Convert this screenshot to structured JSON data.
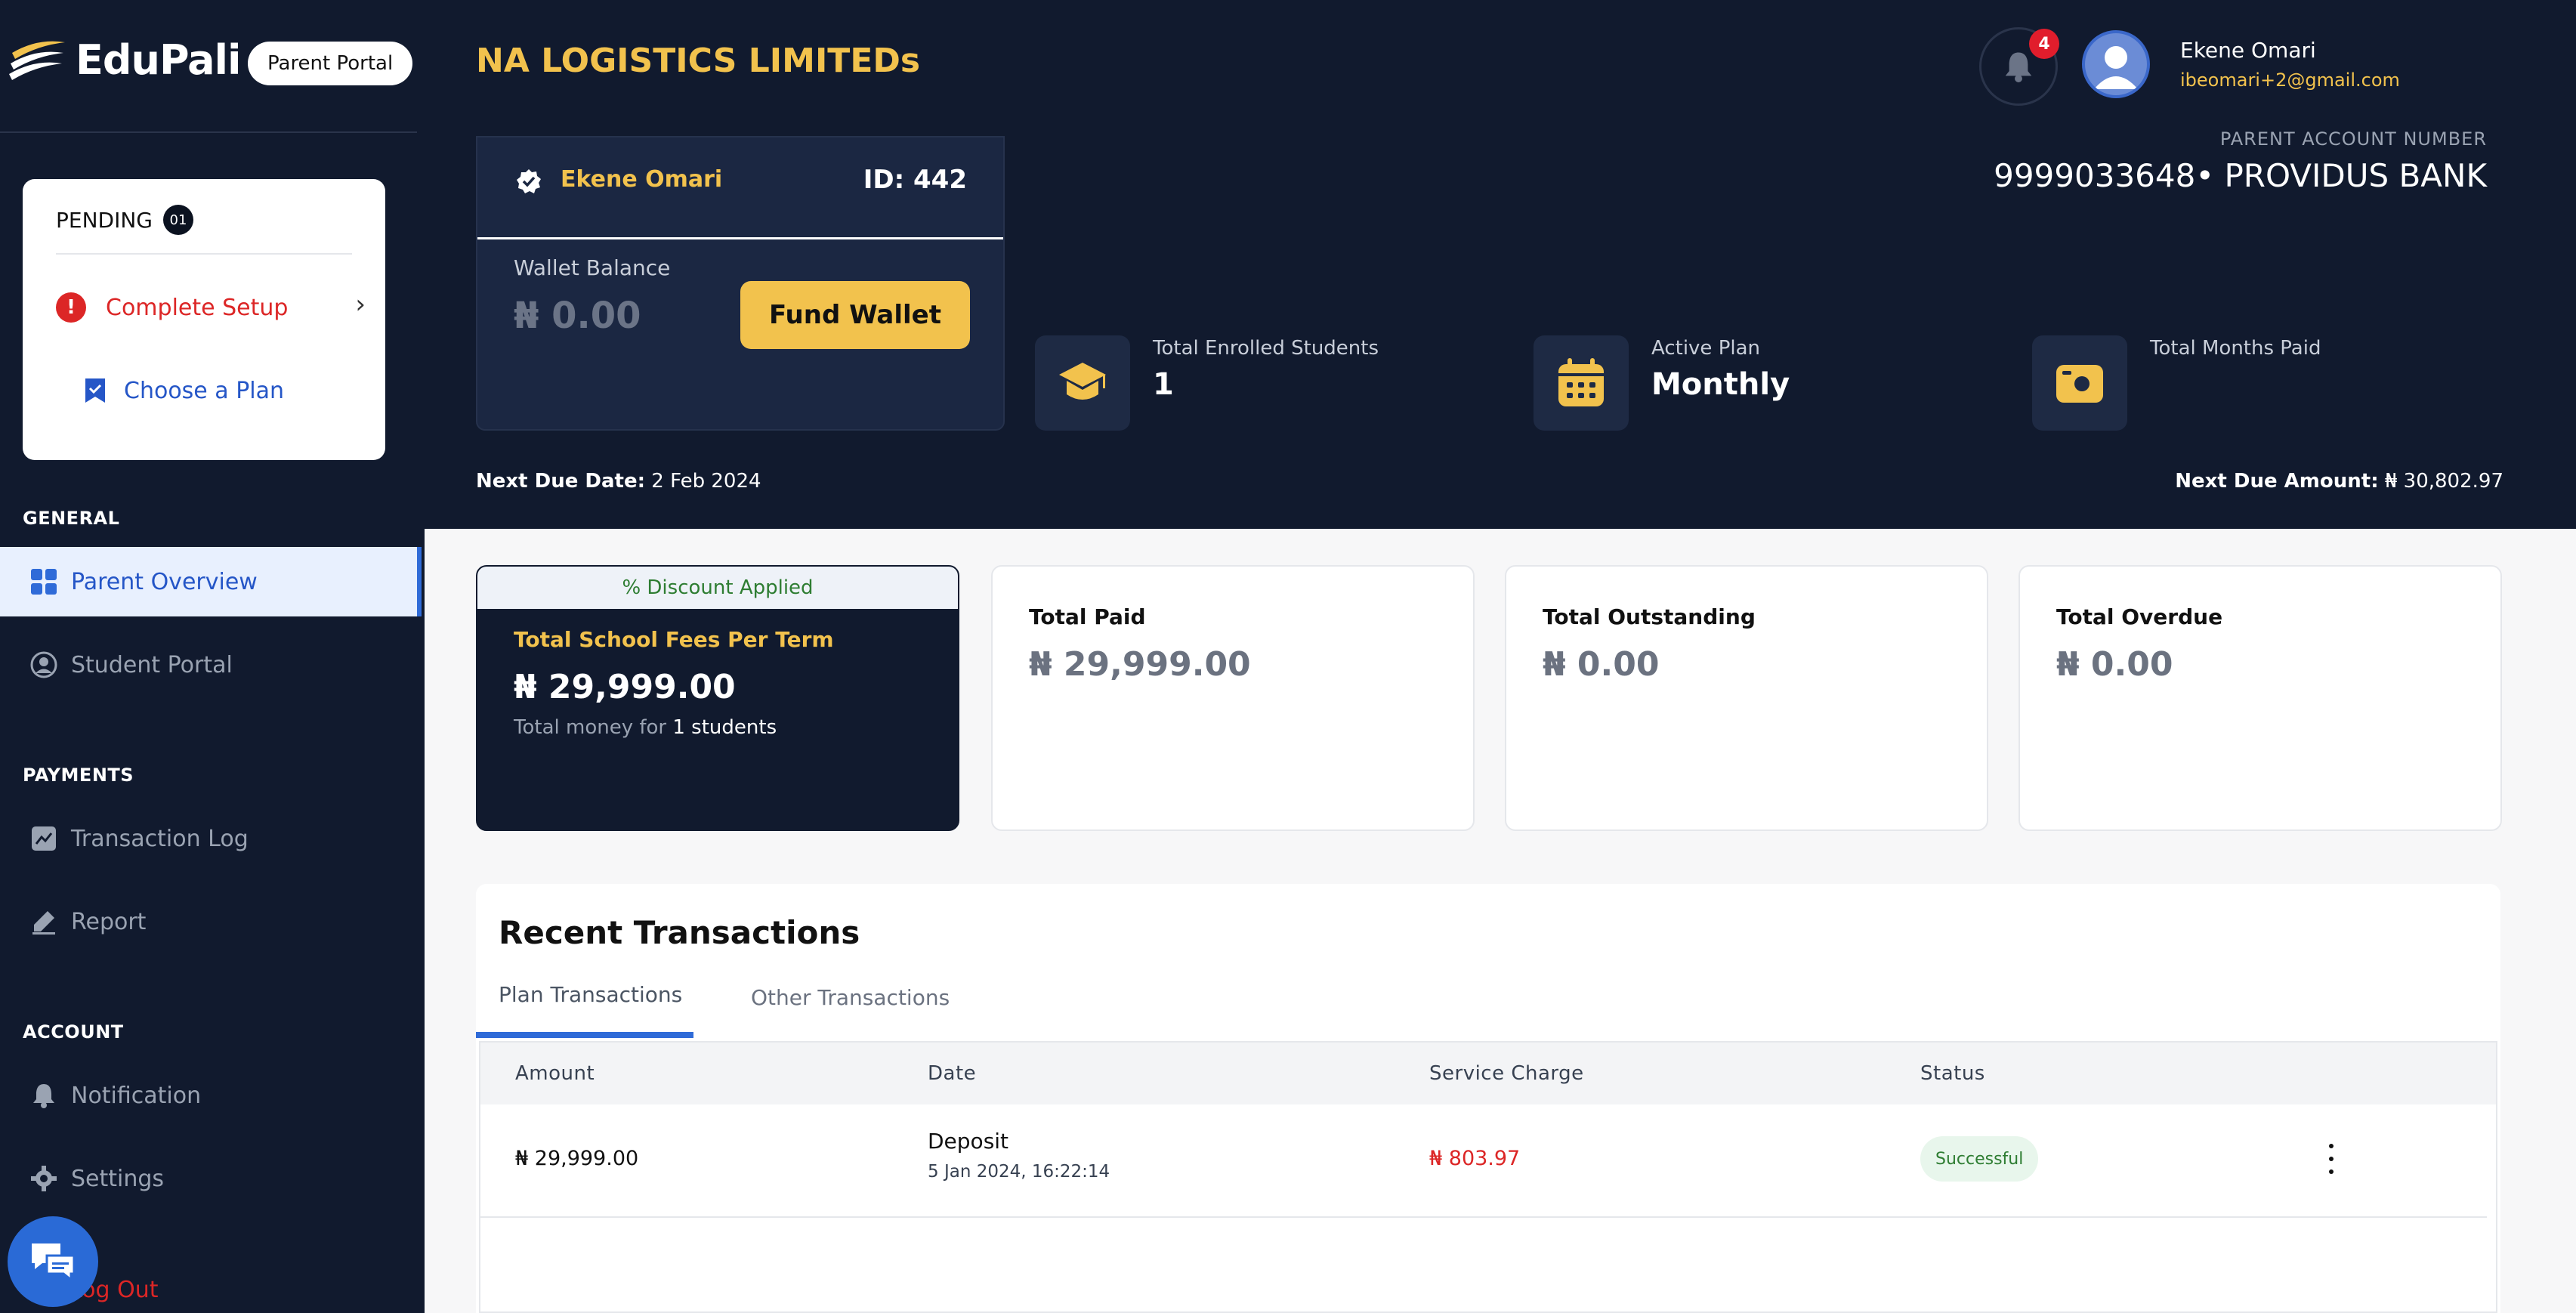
{
  "sidebar": {
    "brand": "EduPali",
    "portal_label": "Parent Portal",
    "pending": {
      "title": "PENDING",
      "count": "01",
      "setup_label": "Complete Setup",
      "plan_label": "Choose a Plan"
    },
    "sections": {
      "general": "GENERAL",
      "payments": "PAYMENTS",
      "account": "ACCOUNT"
    },
    "items": [
      {
        "label": "Parent Overview",
        "icon": "grid-icon"
      },
      {
        "label": "Student Portal",
        "icon": "user-circle-icon"
      },
      {
        "label": "Transaction Log",
        "icon": "chart-icon"
      },
      {
        "label": "Report",
        "icon": "pen-icon"
      },
      {
        "label": "Notification",
        "icon": "bell-icon"
      },
      {
        "label": "Settings",
        "icon": "gear-icon"
      }
    ],
    "logout_label": "Log Out"
  },
  "header": {
    "company": "NA LOGISTICS LIMITEDs",
    "notification_count": "4",
    "user_name": "Ekene Omari",
    "user_email": "ibeomari+2@gmail.com",
    "account_label": "PARENT ACCOUNT NUMBER",
    "account_number": "9999033648• PROVIDUS BANK"
  },
  "wallet": {
    "name": "Ekene Omari",
    "id": "ID: 442",
    "balance_label": "Wallet Balance",
    "balance": "₦ 0.00",
    "fund_label": "Fund Wallet"
  },
  "stats": [
    {
      "label": "Total Enrolled Students",
      "value": "1",
      "icon": "graduation-cap-icon"
    },
    {
      "label": "Active Plan",
      "value": "Monthly",
      "icon": "calendar-icon"
    },
    {
      "label": "Total Months Paid",
      "value": "",
      "icon": "wallet-icon"
    }
  ],
  "due": {
    "date_label": "Next Due Date:",
    "date": "2 Feb 2024",
    "amount_label": "Next Due Amount:",
    "amount": "₦ 30,802.97"
  },
  "fees": {
    "discount": "% Discount Applied",
    "label": "Total School Fees Per Term",
    "amount": "₦ 29,999.00",
    "sub_prefix": "Total money for",
    "sub_value": "1 students"
  },
  "summary": [
    {
      "title": "Total Paid",
      "value": "₦ 29,999.00"
    },
    {
      "title": "Total Outstanding",
      "value": "₦ 0.00"
    },
    {
      "title": "Total Overdue",
      "value": "₦ 0.00"
    }
  ],
  "transactions": {
    "title": "Recent Transactions",
    "tabs": [
      "Plan Transactions",
      "Other Transactions"
    ],
    "columns": [
      "Amount",
      "Date",
      "Service Charge",
      "Status"
    ],
    "rows": [
      {
        "amount": "₦ 29,999.00",
        "type": "Deposit",
        "date": "5 Jan 2024, 16:22:14",
        "service_charge": "₦ 803.97",
        "status": "Successful"
      }
    ]
  },
  "colors": {
    "navy": "#111a2e",
    "gold": "#f2c24d",
    "blue": "#2f6bd8",
    "danger": "#dc2626",
    "success": "#2e7d32"
  }
}
